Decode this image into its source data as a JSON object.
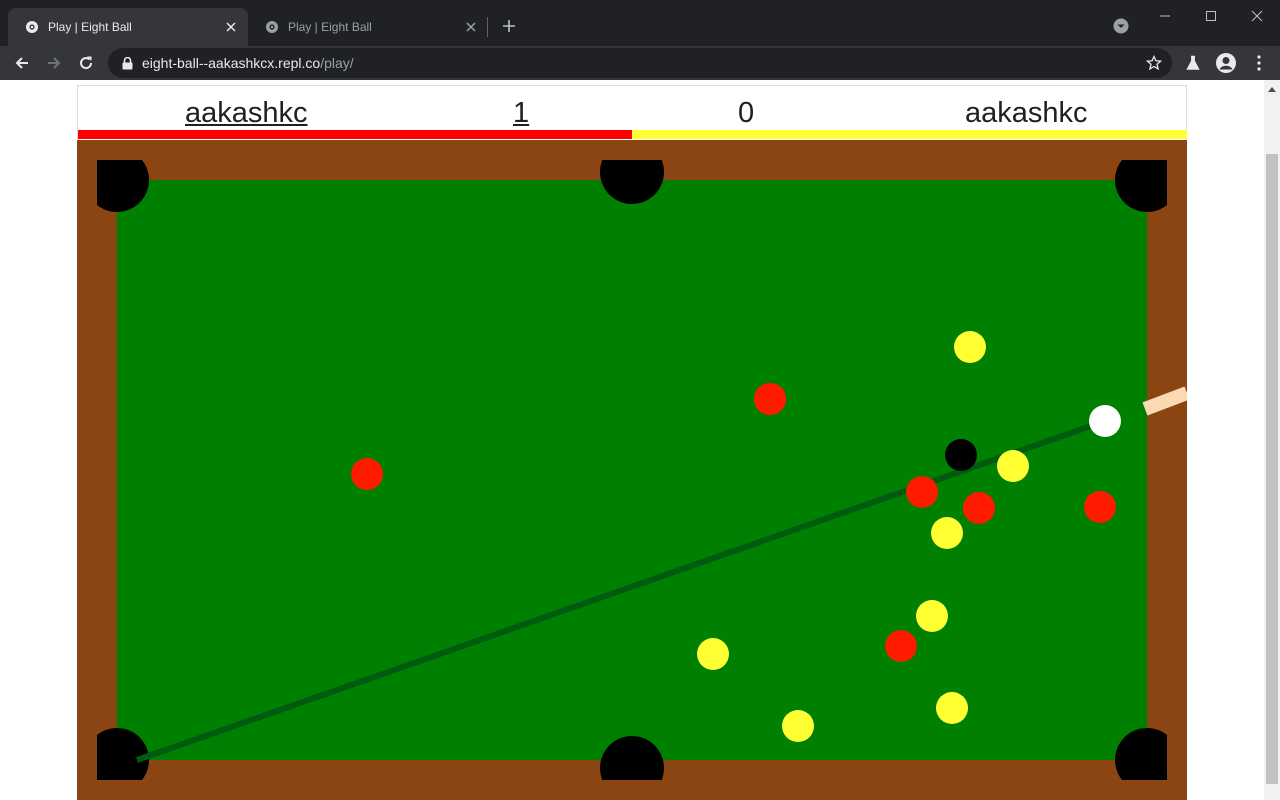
{
  "browser": {
    "tabs": [
      {
        "title": "Play | Eight Ball",
        "active": true
      },
      {
        "title": "Play | Eight Ball",
        "active": false
      }
    ],
    "url_host": "eight-ball--aakashkcx.repl.co",
    "url_path": "/play/"
  },
  "scoreboard": {
    "player_left": "aakashkc",
    "score_left": "1",
    "score_right": "0",
    "player_right": "aakashkc",
    "colors": {
      "left": "#ff0000",
      "right": "#ffff33"
    }
  },
  "table": {
    "felt_color": "#008000",
    "rail_color": "#8b4513",
    "balls": [
      {
        "color": "white"
      },
      {
        "color": "black"
      },
      {
        "color": "red"
      },
      {
        "color": "red"
      },
      {
        "color": "red"
      },
      {
        "color": "red"
      },
      {
        "color": "red"
      },
      {
        "color": "red"
      },
      {
        "color": "red"
      },
      {
        "color": "yellow"
      },
      {
        "color": "yellow"
      },
      {
        "color": "yellow"
      },
      {
        "color": "yellow"
      },
      {
        "color": "yellow"
      },
      {
        "color": "yellow"
      },
      {
        "color": "yellow"
      }
    ],
    "pockets": 6
  }
}
